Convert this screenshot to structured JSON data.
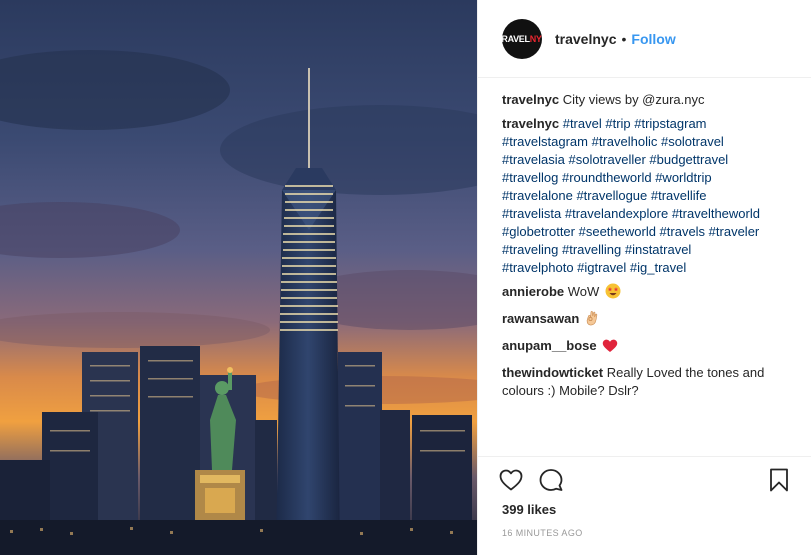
{
  "post": {
    "image_alt": "New York City skyline with One World Trade Center and the Statue of Liberty at sunset"
  },
  "header": {
    "avatar_text_1": "TRAVEL",
    "avatar_text_2": "NYC",
    "username": "travelnyc",
    "separator": "•",
    "follow_label": "Follow"
  },
  "caption": {
    "user": "travelnyc",
    "text": "City views by @zura.nyc"
  },
  "tags_comment": {
    "user": "travelnyc",
    "lines": [
      "#travel #trip #tripstagram",
      "#travelstagram #travelholic #solotravel",
      "#travelasia #solotraveller #budgettravel",
      "#travellog #roundtheworld #worldtrip",
      "#travelalone #travellogue #travellife",
      "#travelista #travelandexplore #traveltheworld",
      "#globetrotter #seetheworld #travels #traveler",
      "#traveling #travelling #instatravel",
      "#travelphoto #igtravel #ig_travel"
    ]
  },
  "comments": [
    {
      "user": "annierobe",
      "text": "WoW",
      "emoji": "star-struck-emoji"
    },
    {
      "user": "rawansawan",
      "text": "",
      "emoji": "ok-hand-emoji"
    },
    {
      "user": "anupam__bose",
      "text": "",
      "emoji": "red-heart-emoji"
    },
    {
      "user": "thewindowticket",
      "text": "Really Loved the tones and colours :) Mobile? Dslr?",
      "emoji": ""
    }
  ],
  "actions": {
    "like_icon": "heart-outline-icon",
    "comment_icon": "comment-bubble-icon",
    "save_icon": "bookmark-icon",
    "likes_text": "399 likes",
    "timestamp": "16 MINUTES AGO"
  },
  "colors": {
    "link": "#3897f0",
    "hashtag": "#003569",
    "text": "#262626",
    "muted": "#999999",
    "heart": "#ed4956"
  }
}
